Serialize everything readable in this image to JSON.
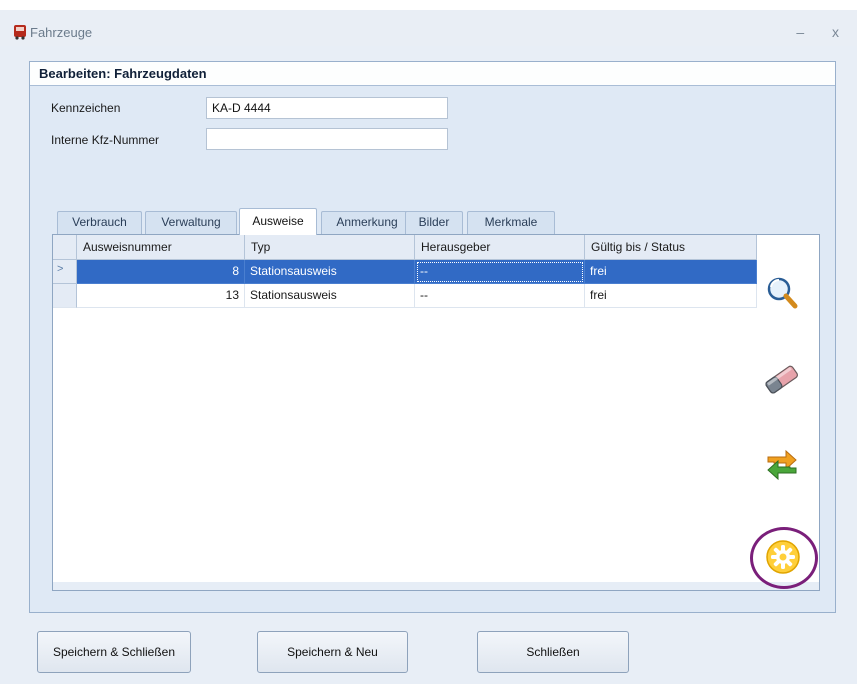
{
  "window": {
    "title": "Fahrzeuge",
    "controls": "– x"
  },
  "panel": {
    "header": "Bearbeiten: Fahrzeugdaten"
  },
  "form": {
    "kennzeichen_label": "Kennzeichen",
    "kennzeichen_value": "KA-D 4444",
    "kfz_label": "Interne Kfz-Nummer",
    "kfz_value": ""
  },
  "tabs": [
    {
      "label": "Verbrauch",
      "active": false
    },
    {
      "label": "Verwaltung",
      "active": false
    },
    {
      "label": "Ausweise",
      "active": true
    },
    {
      "label": "Anmerkung",
      "active": false
    },
    {
      "label": "Bilder",
      "active": false
    },
    {
      "label": "Merkmale",
      "active": false
    }
  ],
  "grid": {
    "columns": [
      "Ausweisnummer",
      "Typ",
      "Herausgeber",
      "Gültig bis / Status"
    ],
    "rows": [
      {
        "indicator": ">",
        "ausweisnummer": "8",
        "typ": "Stationsausweis",
        "herausgeber": "--",
        "status": "frei",
        "selected": true
      },
      {
        "indicator": "",
        "ausweisnummer": "13",
        "typ": "Stationsausweis",
        "herausgeber": "--",
        "status": "frei",
        "selected": false
      }
    ]
  },
  "side_actions": [
    {
      "icon": "magnifier-icon"
    },
    {
      "icon": "eraser-icon"
    },
    {
      "icon": "refresh-arrows-icon"
    },
    {
      "icon": "gear-icon"
    }
  ],
  "buttons": {
    "save_close": "Speichern & Schließen",
    "save_new": "Speichern & Neu",
    "close": "Schließen"
  },
  "colors": {
    "selection": "#316ac5",
    "highlight_circle": "#7a1f7a"
  }
}
